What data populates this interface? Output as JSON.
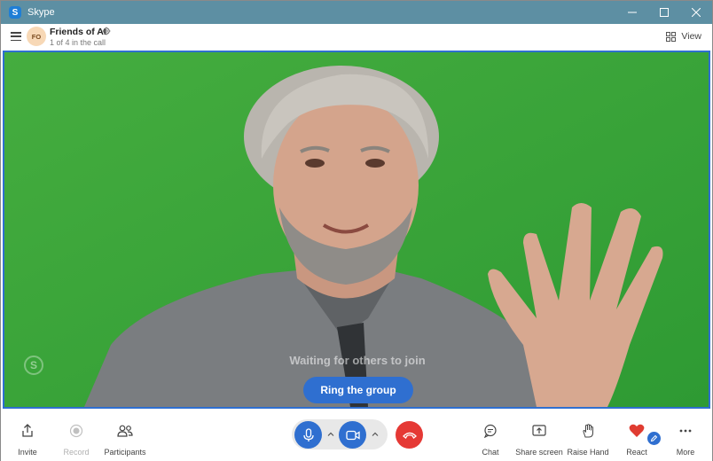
{
  "window": {
    "app_title": "Skype",
    "app_logo_letter": "S"
  },
  "call_header": {
    "avatar_initials": "FO",
    "group_name": "Friends of AI",
    "call_count": "1 of 4 in the call",
    "view_label": "View"
  },
  "video": {
    "watermark": "S",
    "waiting_text": "Waiting for others to join",
    "ring_button": "Ring the group"
  },
  "toolbar": {
    "invite": "Invite",
    "record": "Record",
    "participants": "Participants",
    "chat": "Chat",
    "share_screen": "Share screen",
    "raise_hand": "Raise Hand",
    "react": "React",
    "more": "More"
  },
  "colors": {
    "titlebar": "#5d8fa3",
    "accent": "#2f6fd0",
    "end_call": "#e53935",
    "green_screen": "#3ba53a",
    "react_heart": "#e03c31"
  },
  "icons": [
    "menu-icon",
    "settings-icon",
    "grid-view-icon",
    "share-icon",
    "record-icon",
    "participants-icon",
    "microphone-icon",
    "video-camera-icon",
    "hang-up-icon",
    "chat-icon",
    "share-screen-icon",
    "hand-icon",
    "heart-icon",
    "pencil-icon",
    "more-icon"
  ]
}
